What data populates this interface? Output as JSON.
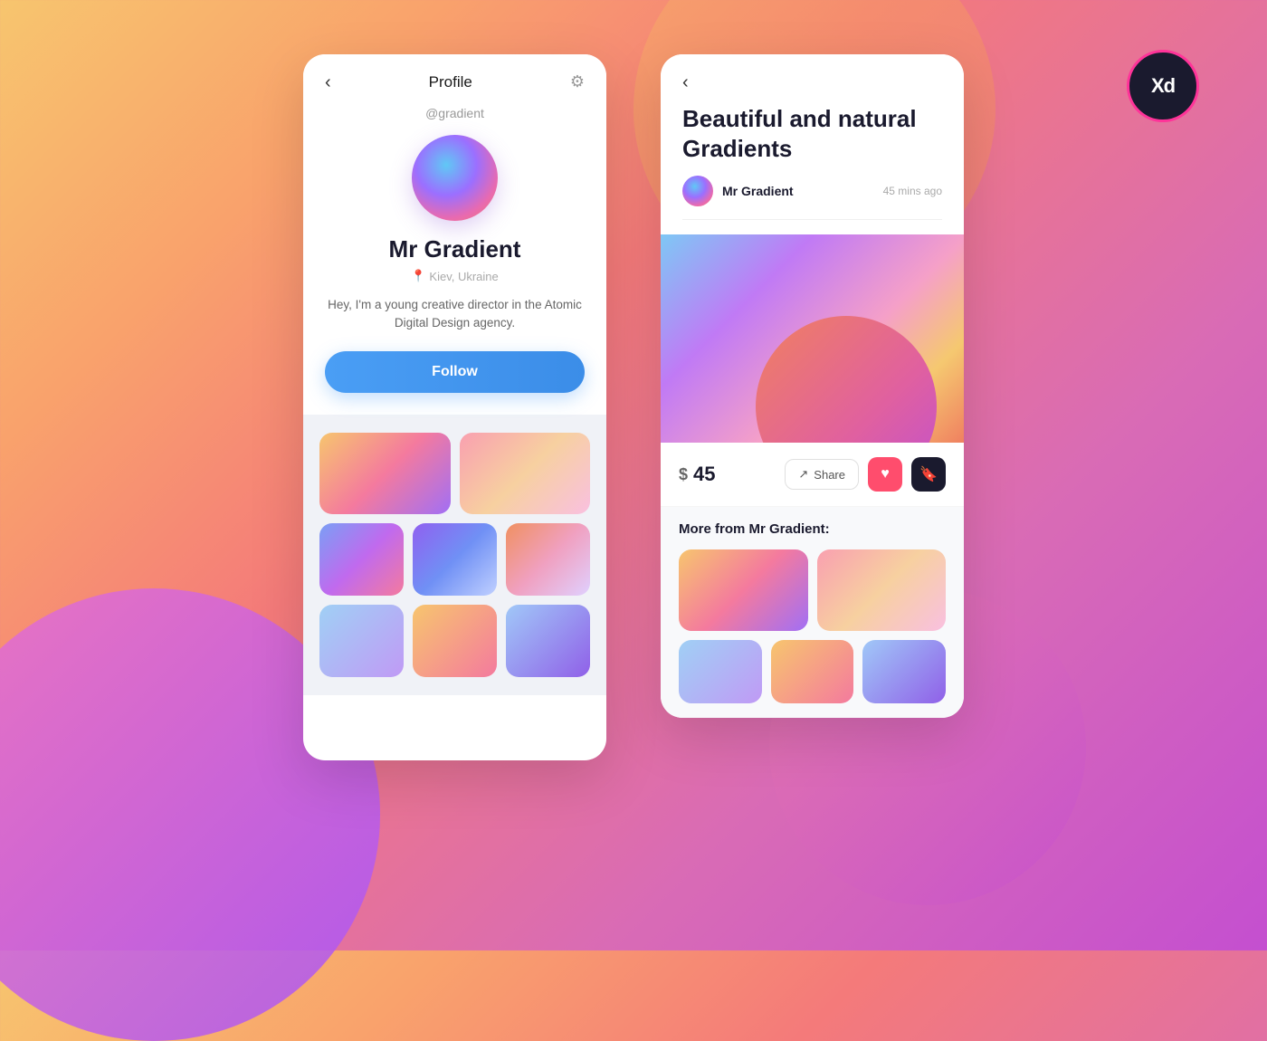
{
  "background": {
    "gradient": "linear-gradient(135deg, #f7c56e 0%, #f9a26c 20%, #f47a7a 40%, #d96bb5 70%, #c44fd0 100%)"
  },
  "xd_badge": {
    "label": "Xd"
  },
  "profile_card": {
    "back_label": "‹",
    "title": "Profile",
    "username": "@gradient",
    "display_name": "Mr Gradient",
    "location": "Kiev, Ukraine",
    "bio": "Hey, I'm a young creative director in the Atomic Digital Design agency.",
    "follow_label": "Follow"
  },
  "detail_card": {
    "back_label": "‹",
    "title": "Beautiful and natural Gradients",
    "author_name": "Mr Gradient",
    "post_time": "45 mins ago",
    "price_symbol": "$",
    "price": "45",
    "share_label": "Share",
    "more_from_label": "More from Mr Gradient:"
  }
}
